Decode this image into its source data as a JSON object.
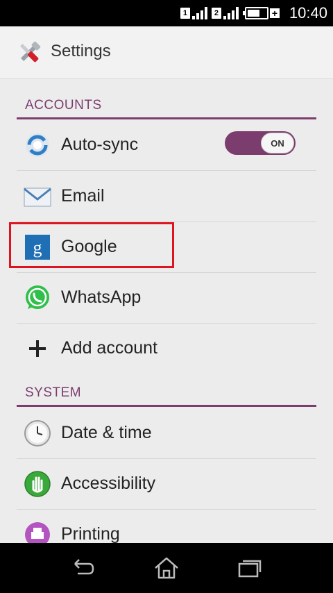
{
  "status_bar": {
    "sim1_label": "1",
    "sim2_label": "2",
    "time": "10:40",
    "battery_level": 0.75
  },
  "header": {
    "title": "Settings",
    "icon": "settings-tools-icon"
  },
  "sections": {
    "accounts": {
      "title": "ACCOUNTS",
      "items": [
        {
          "label": "Auto-sync",
          "icon": "sync-icon",
          "toggle": "ON"
        },
        {
          "label": "Email",
          "icon": "email-icon"
        },
        {
          "label": "Google",
          "icon": "google-icon"
        },
        {
          "label": "WhatsApp",
          "icon": "whatsapp-icon"
        },
        {
          "label": "Add account",
          "icon": "plus-icon"
        }
      ]
    },
    "system": {
      "title": "SYSTEM",
      "items": [
        {
          "label": "Date & time",
          "icon": "clock-icon"
        },
        {
          "label": "Accessibility",
          "icon": "accessibility-hand-icon"
        },
        {
          "label": "Printing",
          "icon": "printer-icon"
        }
      ]
    }
  },
  "colors": {
    "accent": "#7b3c6e",
    "highlight": "#e0141e"
  },
  "navigation": {
    "back": "back-icon",
    "home": "home-icon",
    "recents": "recents-icon"
  }
}
